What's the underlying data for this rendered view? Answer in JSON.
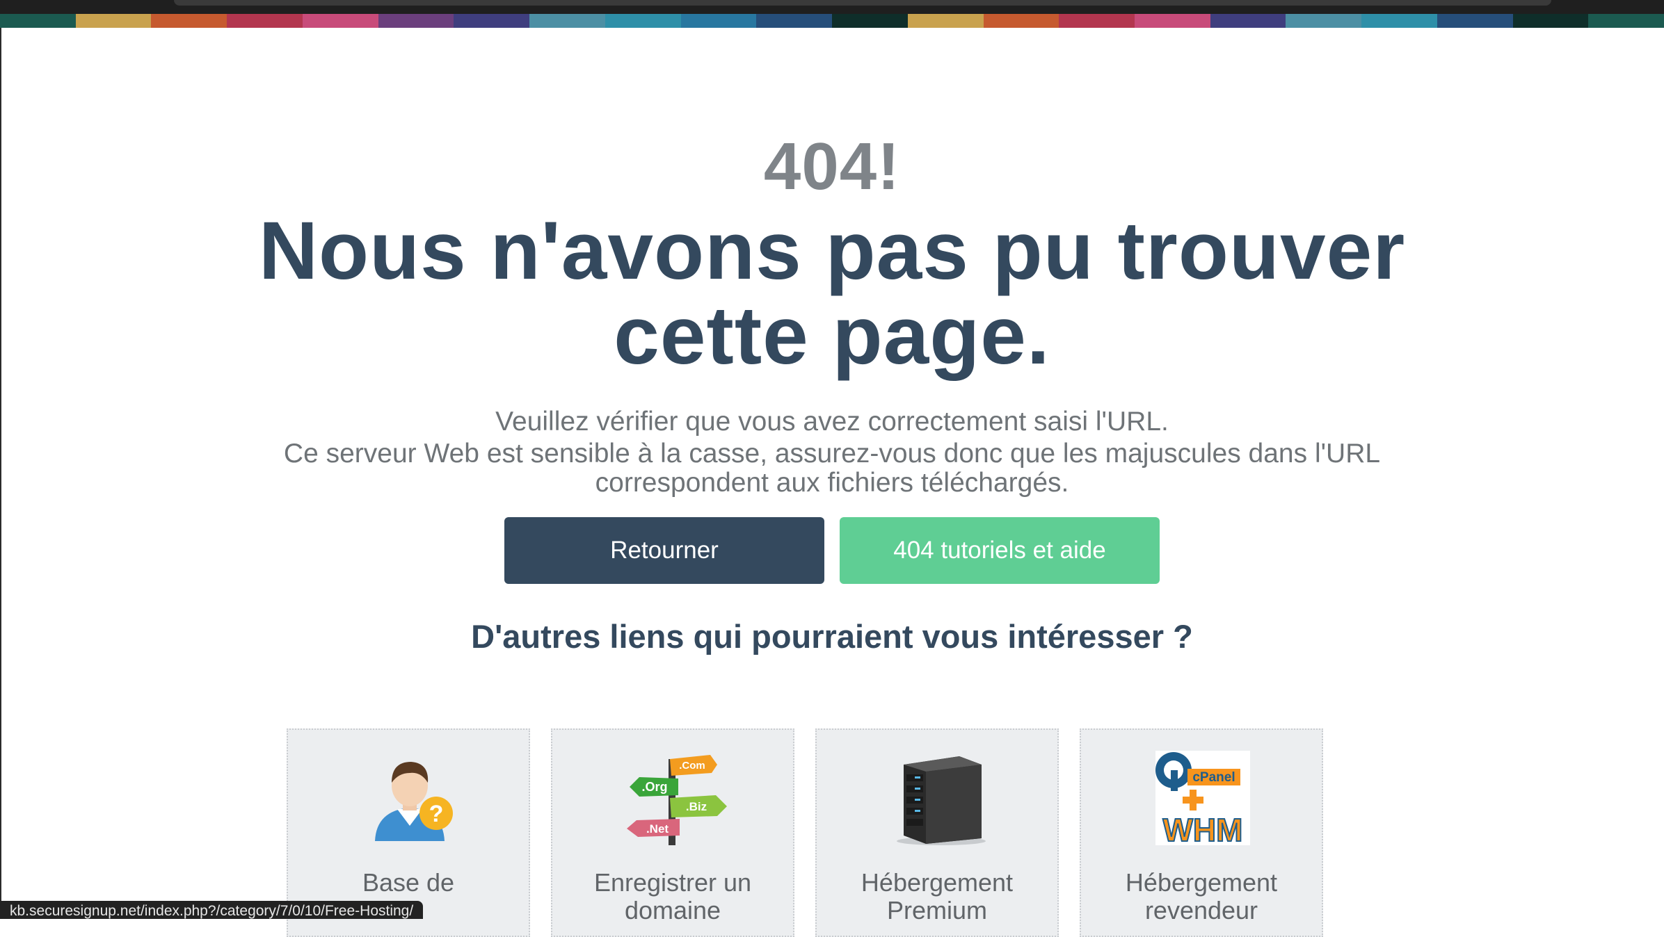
{
  "colors": {
    "strip": [
      "#1b5a50",
      "#c9a24e",
      "#c65a2f",
      "#b3364f",
      "#c84b7a",
      "#6b3f7d",
      "#3f3e7e",
      "#4c8fa4",
      "#2e8fa8",
      "#2877a0",
      "#264e7a",
      "#0f2e2a",
      "#c9a24e",
      "#c65a2f",
      "#b3364f",
      "#c84b7a",
      "#3f3e7e",
      "#4c8fa4",
      "#2e8fa8",
      "#264e7a",
      "#0f2e2a",
      "#1b5a50"
    ],
    "headline": "#34495e",
    "code": "#7f8489",
    "button_back": "#34495e",
    "button_help": "#5fce94"
  },
  "hero": {
    "code": "404!",
    "title": "Nous n'avons pas pu trouver cette page.",
    "line1": "Veuillez vérifier que vous avez correctement saisi l'URL.",
    "line2": "Ce serveur Web est sensible à la casse, assurez-vous donc que les majuscules dans l'URL correspondent aux fichiers téléchargés."
  },
  "buttons": {
    "back": "Retourner",
    "help": "404 tutoriels et aide"
  },
  "links_heading": "D'autres liens qui pourraient vous intéresser ?",
  "cards": [
    {
      "label": "Base de",
      "icon": "user-question-icon"
    },
    {
      "label": "Enregistrer un domaine",
      "icon": "domain-signpost-icon",
      "sign_labels": [
        ".Com",
        ".Org",
        ".Biz",
        ".Net"
      ]
    },
    {
      "label": "Hébergement Premium",
      "icon": "server-icon"
    },
    {
      "label": "Hébergement revendeur",
      "icon": "cpanel-whm-icon",
      "logo_text": [
        "cPanel",
        "WHM"
      ]
    }
  ],
  "status_bar": {
    "url": "kb.securesignup.net/index.php?/category/7/0/10/Free-Hosting/"
  }
}
